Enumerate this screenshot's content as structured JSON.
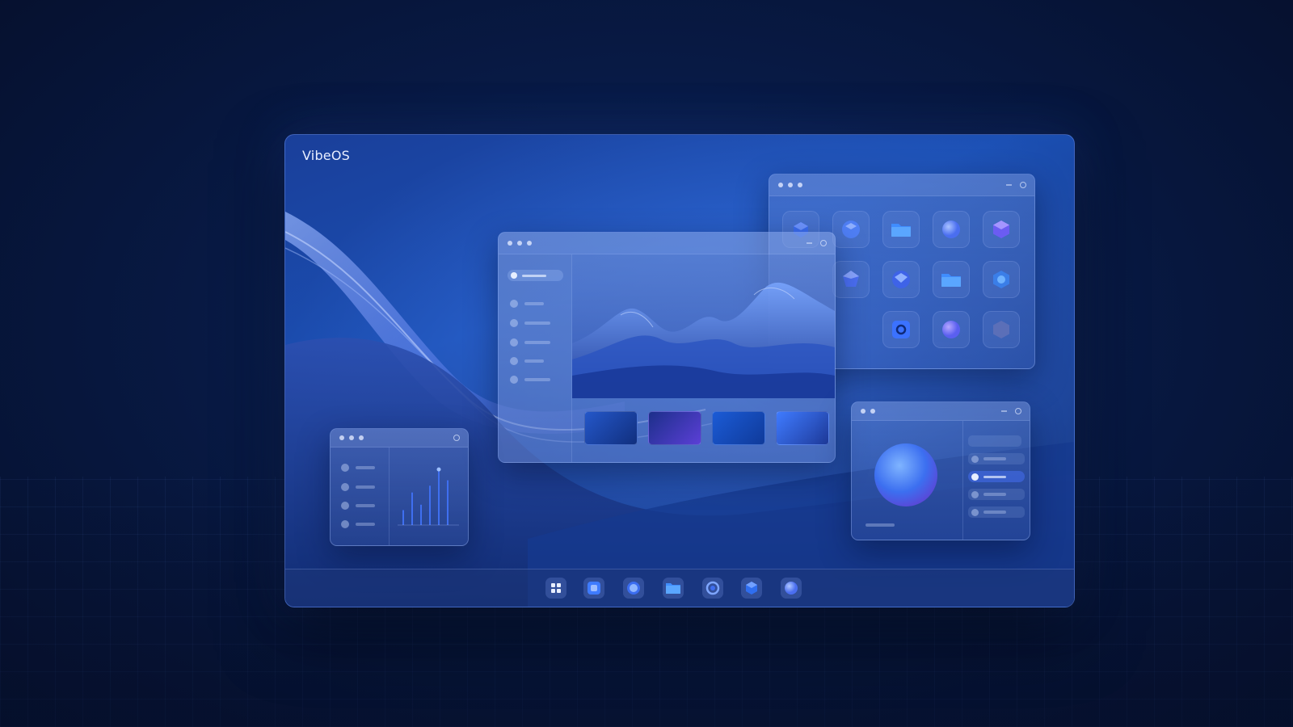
{
  "desktop": {
    "brand": "VibeOS"
  },
  "icons": {
    "dock": [
      "apps-grid-icon",
      "square-app-icon",
      "circle-app-icon",
      "folder-icon",
      "ring-app-icon",
      "cube-icon",
      "sphere-app-icon"
    ]
  },
  "colors": {
    "background": "#081a45",
    "accent": "#3b7bff",
    "orb": "#4f8cff"
  },
  "chart_data": {
    "type": "bar",
    "values": [
      22,
      48,
      30,
      58,
      82,
      66
    ],
    "ylim": [
      0,
      100
    ]
  }
}
